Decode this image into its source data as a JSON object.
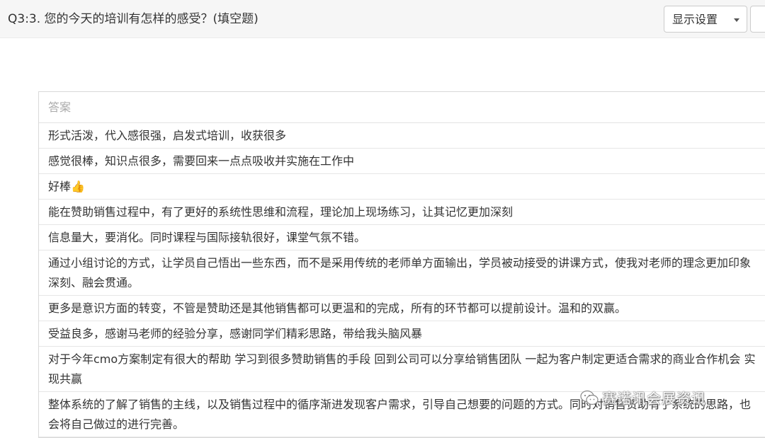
{
  "question": {
    "title": "Q3:3. 您的今天的培训有怎样的感受？(填空题)"
  },
  "toolbar": {
    "display_settings_label": "显示设置"
  },
  "table": {
    "header": "答案",
    "rows": [
      "形式活泼，代入感很强，启发式培训，收获很多",
      "感觉很棒，知识点很多，需要回来一点点吸收并实施在工作中",
      "好棒👍",
      "能在赞助销售过程中，有了更好的系统性思维和流程，理论加上现场练习，让其记忆更加深刻",
      "信息量大，要消化。同时课程与国际接轨很好，课堂气氛不错。",
      "通过小组讨论的方式，让学员自己悟出一些东西，而不是采用传统的老师单方面输出，学员被动接受的讲课方式，使我对老师的理念更加印象深刻、融会贯通。",
      "更多是意识方面的转变，不管是赞助还是其他销售都可以更温和的完成，所有的环节都可以提前设计。温和的双赢。",
      "受益良多，感谢马老师的经验分享，感谢同学们精彩思路，带给我头脑风暴",
      "对于今年cmo方案制定有很大的帮助 学习到很多赞助销售的手段 回到公司可以分享给销售团队 一起为客户制定更适合需求的商业合作机会 实现共赢",
      "整体系统的了解了销售的主线，以及销售过程中的循序渐进发现客户需求，引导自己想要的问题的方式。同时对销售赞助有了系统的思路，也会将自己做过的进行完善。"
    ]
  },
  "watermark": {
    "text": "赛诺讯会展资讯",
    "icon": "wechat-icon"
  }
}
